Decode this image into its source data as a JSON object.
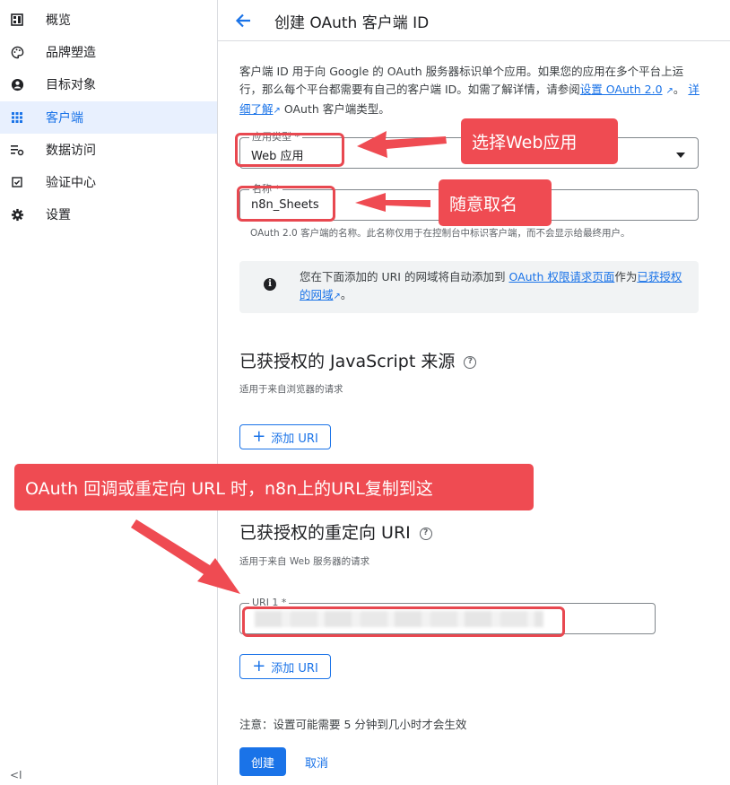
{
  "sidebar": {
    "items": [
      {
        "label": "概览",
        "icon": "dashboard-icon"
      },
      {
        "label": "品牌塑造",
        "icon": "palette-icon"
      },
      {
        "label": "目标对象",
        "icon": "person-icon"
      },
      {
        "label": "客户端",
        "icon": "grid-icon",
        "active": true
      },
      {
        "label": "数据访问",
        "icon": "data-access-icon"
      },
      {
        "label": "验证中心",
        "icon": "checkbox-icon"
      },
      {
        "label": "设置",
        "icon": "gear-icon"
      }
    ],
    "collapse_label": "<I"
  },
  "header": {
    "title": "创建 OAuth 客户端 ID"
  },
  "intro": {
    "text_1": "客户端 ID 用于向 Google 的 OAuth 服务器标识单个应用。如果您的应用在多个平台上运行，那么每个平台都需要有自己的客户端 ID。如需了解详情，请参阅",
    "link_1": "设置 OAuth 2.0",
    "sep": "。",
    "link_2": "详细了解",
    "text_2": "OAuth 客户端类型。"
  },
  "app_type": {
    "label": "应用类型 *",
    "value": "Web 应用"
  },
  "name_field": {
    "label": "名称 *",
    "value": "n8n_Sheets",
    "helper": "OAuth 2.0 客户端的名称。此名称仅用于在控制台中标识客户端，而不会显示给最终用户。"
  },
  "info": {
    "text_1": "您在下面添加的 URI 的网域将自动添加到",
    "link_1": "OAuth 权限请求页面",
    "text_2": "作为",
    "link_2": "已获授权的网域",
    "text_3": "。"
  },
  "js_origins": {
    "title": "已获授权的 JavaScript 来源",
    "subtitle": "适用于来自浏览器的请求",
    "add_label": "添加 URI"
  },
  "redirect_uris": {
    "title": "已获授权的重定向 URI",
    "subtitle": "适用于来自 Web 服务器的请求",
    "uri_label": "URI 1 *",
    "add_label": "添加 URI"
  },
  "footer": {
    "note": "注意：设置可能需要 5 分钟到几小时才会生效",
    "create_label": "创建",
    "cancel_label": "取消"
  },
  "annotations": {
    "callout_1": "选择Web应用",
    "callout_2": "随意取名",
    "callout_3": "OAuth 回调或重定向 URL 时，n8n上的URL复制到这"
  },
  "colors": {
    "accent": "#1a73e8",
    "active_bg": "#e8f0fe",
    "annotation_red": "#ef4b52"
  }
}
